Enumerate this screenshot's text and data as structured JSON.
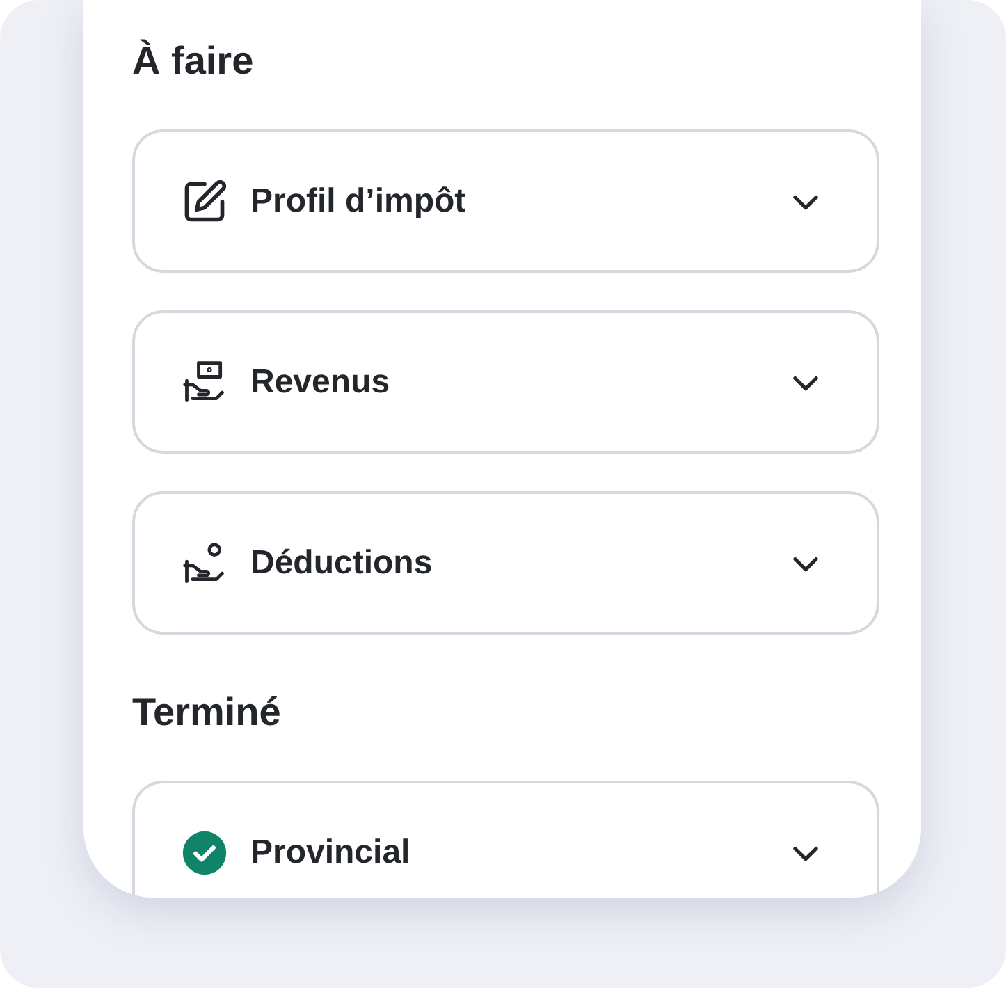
{
  "sections": [
    {
      "title": "À faire",
      "items": [
        {
          "label": "Profil d’impôt",
          "kind": "edit",
          "expanded": false
        },
        {
          "label": "Revenus",
          "kind": "income",
          "expanded": false
        },
        {
          "label": "Déductions",
          "kind": "deduction",
          "expanded": false
        }
      ]
    },
    {
      "title": "Terminé",
      "items": [
        {
          "label": "Provincial",
          "kind": "done",
          "expanded": false
        }
      ]
    }
  ]
}
